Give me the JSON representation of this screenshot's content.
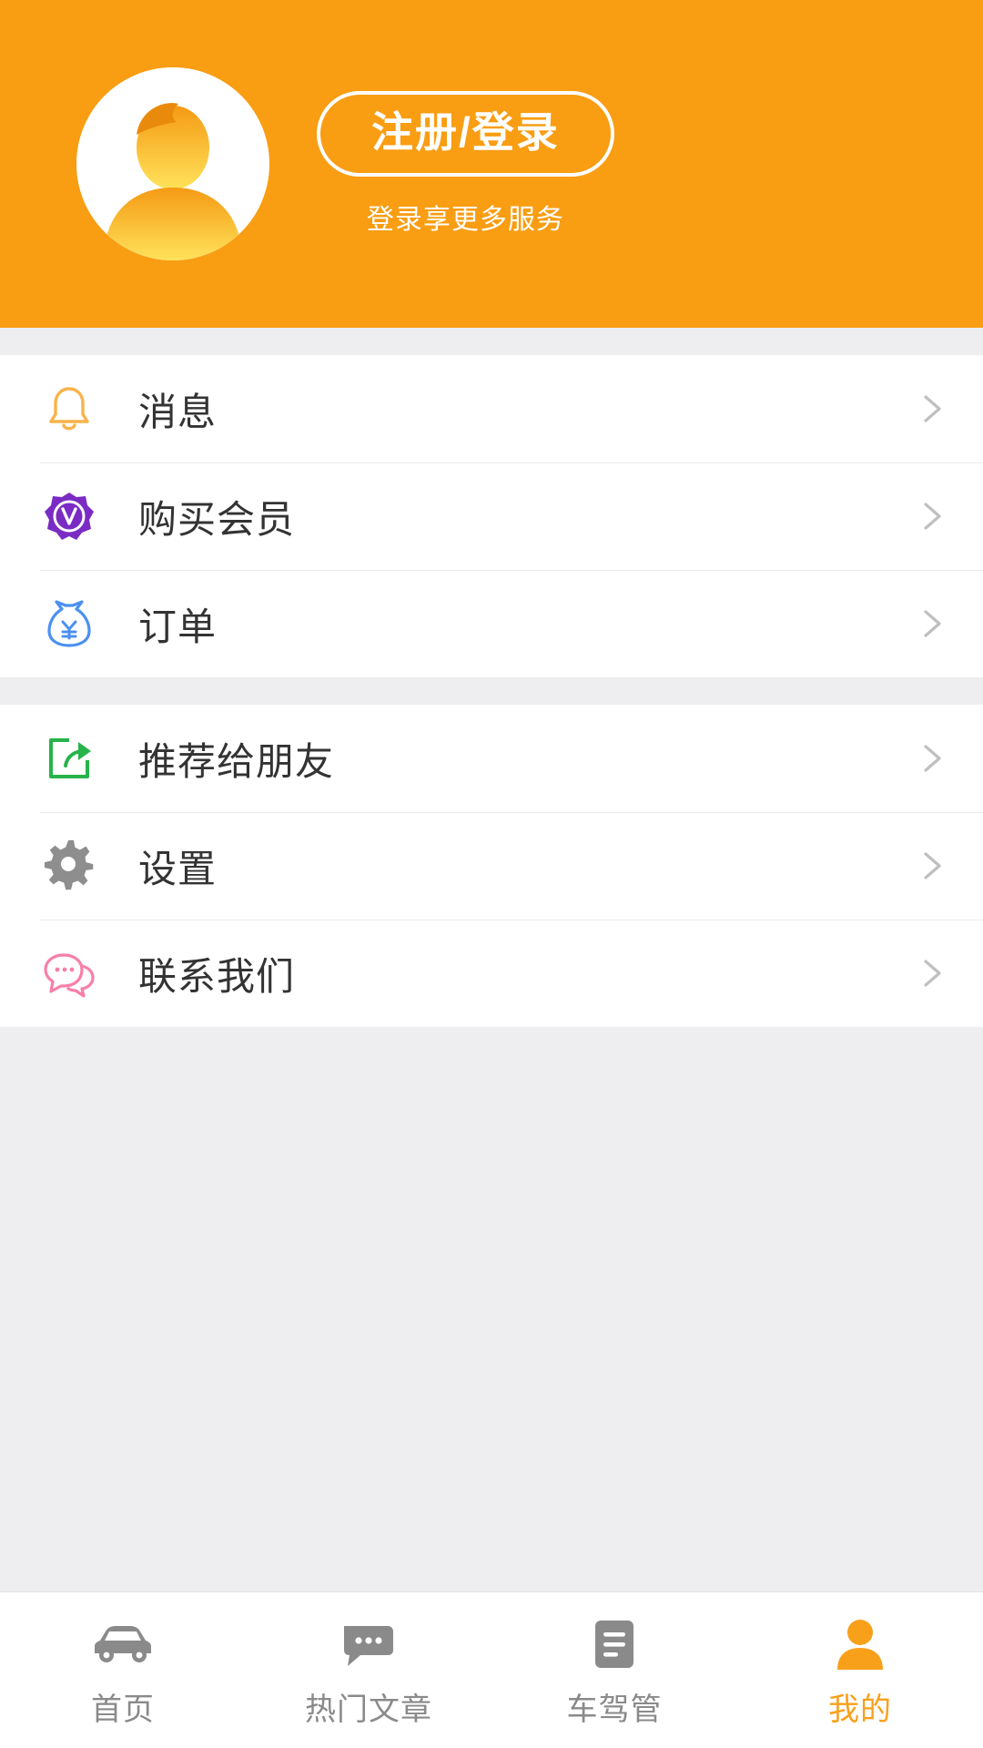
{
  "app": {
    "screen_name": "个人中心",
    "colors": {
      "header_bg": "#F99D12",
      "page_bg": "#EEEEF0",
      "row_bg": "#FFFFFF",
      "label": "#333333",
      "chevron": "#BFBFBF",
      "tab_inactive": "#8A8A8A",
      "tab_active": "#F9A01B"
    }
  },
  "header": {
    "avatar_icon": "default-user-avatar-icon",
    "login_button": "注册/登录",
    "login_subtitle": "登录享更多服务"
  },
  "groups": [
    {
      "rows": [
        {
          "icon": "bell-icon",
          "icon_color": "#F9B34A",
          "label": "消息",
          "chevron": "chevron-right-icon"
        },
        {
          "icon": "vip-badge-icon",
          "icon_color": "#7A2BC4",
          "label": "购买会员",
          "chevron": "chevron-right-icon"
        },
        {
          "icon": "money-bag-icon",
          "icon_color": "#4A90F0",
          "label": "订单",
          "chevron": "chevron-right-icon"
        }
      ]
    },
    {
      "rows": [
        {
          "icon": "share-icon",
          "icon_color": "#27B34A",
          "label": "推荐给朋友",
          "chevron": "chevron-right-icon"
        },
        {
          "icon": "gear-icon",
          "icon_color": "#8E8E8E",
          "label": "设置",
          "chevron": "chevron-right-icon"
        },
        {
          "icon": "chat-bubbles-icon",
          "icon_color": "#F77FA8",
          "label": "联系我们",
          "chevron": "chevron-right-icon"
        }
      ]
    }
  ],
  "tabbar": {
    "items": [
      {
        "icon": "car-icon",
        "label": "首页",
        "active": false
      },
      {
        "icon": "comment-icon",
        "label": "热门文章",
        "active": false
      },
      {
        "icon": "document-icon",
        "label": "车驾管",
        "active": false
      },
      {
        "icon": "person-icon",
        "label": "我的",
        "active": true
      }
    ]
  }
}
